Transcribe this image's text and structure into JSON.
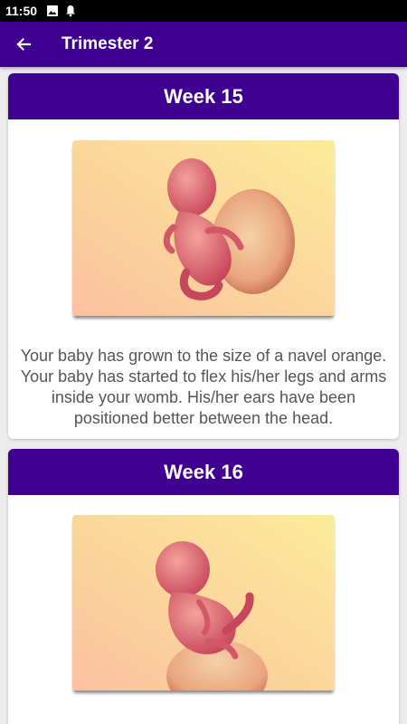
{
  "status_bar": {
    "time": "11:50",
    "icons": [
      "image-icon",
      "bell-icon"
    ]
  },
  "app_bar": {
    "title": "Trimester 2",
    "back_icon": "arrow-back-icon",
    "color": "#3F0091"
  },
  "cards": [
    {
      "week_label": "Week 15",
      "image": "fetus-illustration-week-15",
      "description": "Your baby has grown to the size of a navel orange. Your baby has started to flex his/her legs and arms inside your womb. His/her ears have been positioned better between the head."
    },
    {
      "week_label": "Week 16",
      "image": "fetus-illustration-week-16",
      "description": ""
    }
  ]
}
